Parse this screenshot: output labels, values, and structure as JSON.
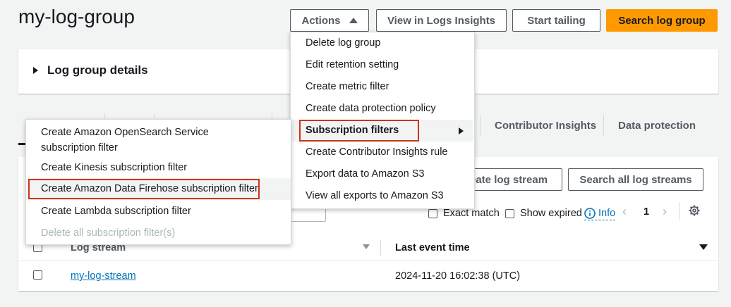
{
  "header": {
    "title": "my-log-group",
    "actions_label": "Actions",
    "insights_label": "View in Logs Insights",
    "tail_label": "Start tailing",
    "search_label": "Search log group"
  },
  "details": {
    "label": "Log group details"
  },
  "tabs": {
    "contributor": "Contributor Insights",
    "protection": "Data protection"
  },
  "streams": {
    "create_label": "Create log stream",
    "create_visible": "eate log stream",
    "search_all_label": "Search all log streams",
    "exact_match": "Exact match",
    "show_expired": "Show expired",
    "info": "Info",
    "page": "1",
    "col_stream": "Log stream",
    "col_time": "Last event time",
    "rows": [
      {
        "stream": "my-log-stream",
        "time": "2024-11-20 16:02:38 (UTC)"
      }
    ]
  },
  "actions_menu": {
    "items": [
      "Delete log group",
      "Edit retention setting",
      "Create metric filter",
      "Create data protection policy",
      "Subscription filters",
      "Create Contributor Insights rule",
      "Export data to Amazon S3",
      "View all exports to Amazon S3"
    ]
  },
  "sub_menu": {
    "items": [
      "Create Amazon OpenSearch Service subscription filter",
      "Create Kinesis subscription filter",
      "Create Amazon Data Firehose subscription filter",
      "Create Lambda subscription filter",
      "Delete all subscription filter(s)"
    ]
  },
  "colors": {
    "primary": "#ff9900",
    "link": "#0073bb",
    "highlight_border": "#d13212"
  }
}
